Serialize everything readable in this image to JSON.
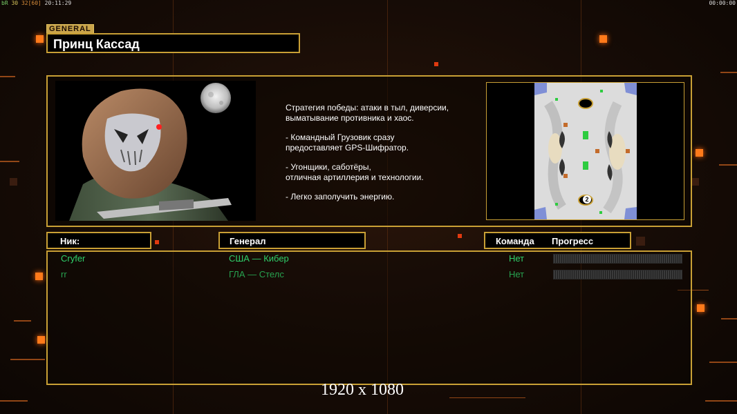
{
  "hud": {
    "left_prefix": "bR",
    "left_a": "30",
    "left_b": "32",
    "left_c": "[60]",
    "left_time": "20:11:29",
    "right_time": "00:00:00"
  },
  "general": {
    "tag": "GENERAL",
    "name": "Принц Кассад"
  },
  "description": [
    "Стратегия победы: атаки в тыл, диверсии,\n выматывание противника и хаос.",
    "- Командный Грузовик сразу\nпредоставляет GPS-Шифратор.",
    "- Угонщики, саботёры,\nотличная артиллерия и технологии.",
    "- Легко заполучить энергию."
  ],
  "headers": {
    "nick": "Ник:",
    "general": "Генерал",
    "team": "Команда",
    "progress": "Прогресс"
  },
  "players": [
    {
      "nick": "Cryfer",
      "general": "США — Кибер",
      "team": "Нет",
      "color": "#2fd06a"
    },
    {
      "nick": "rr",
      "general": "ГЛА — Стелс",
      "team": "Нет",
      "color": "#27a24f"
    }
  ],
  "map": {
    "start_marker": "2"
  },
  "footer": {
    "resolution": "1920 x 1080"
  },
  "colors": {
    "accent_gold": "#c9a035",
    "accent_orange": "#ff7a1a"
  }
}
